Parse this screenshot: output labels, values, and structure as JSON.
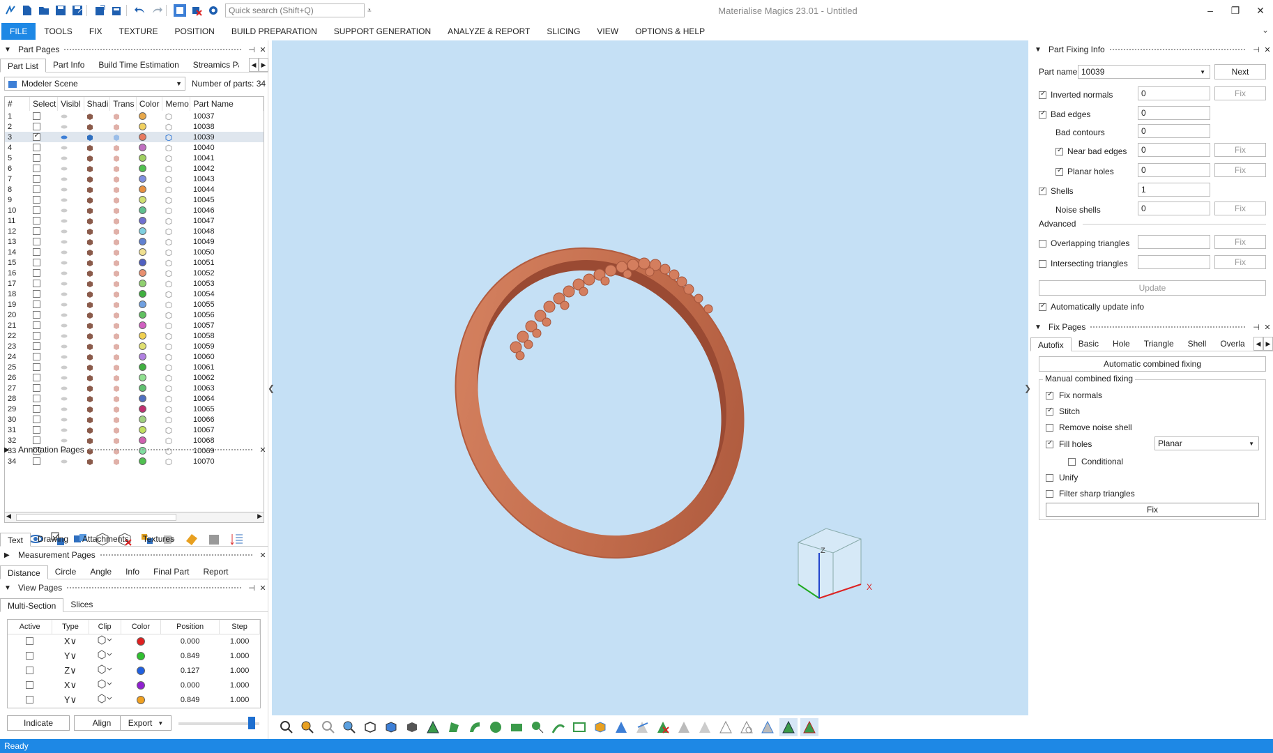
{
  "app": {
    "title": "Materialise Magics 23.01 - Untitled"
  },
  "quick_search": {
    "placeholder": "Quick search (Shift+Q)"
  },
  "ribbon": {
    "tabs": [
      "FILE",
      "TOOLS",
      "FIX",
      "TEXTURE",
      "POSITION",
      "BUILD PREPARATION",
      "SUPPORT GENERATION",
      "ANALYZE & REPORT",
      "SLICING",
      "VIEW",
      "OPTIONS & HELP"
    ]
  },
  "part_pages": {
    "title": "Part Pages",
    "tabs": [
      "Part List",
      "Part Info",
      "Build Time Estimation",
      "Streamics Part"
    ],
    "scene": "Modeler Scene",
    "number_of_parts_label": "Number of parts:",
    "number_of_parts": "34",
    "columns": [
      "#",
      "Select",
      "Visibl",
      "Shadi",
      "Trans",
      "Color",
      "Memo",
      "Part Name"
    ],
    "rows": [
      {
        "n": "1",
        "name": "10037",
        "color": "#e8a84a"
      },
      {
        "n": "2",
        "name": "10038",
        "color": "#f0d060"
      },
      {
        "n": "3",
        "name": "10039",
        "color": "#e87a60",
        "selected": true
      },
      {
        "n": "4",
        "name": "10040",
        "color": "#c070c0"
      },
      {
        "n": "5",
        "name": "10041",
        "color": "#a0d060"
      },
      {
        "n": "6",
        "name": "10042",
        "color": "#50c050"
      },
      {
        "n": "7",
        "name": "10043",
        "color": "#8090e0"
      },
      {
        "n": "8",
        "name": "10044",
        "color": "#e89040"
      },
      {
        "n": "9",
        "name": "10045",
        "color": "#d0e070"
      },
      {
        "n": "10",
        "name": "10046",
        "color": "#60c090"
      },
      {
        "n": "11",
        "name": "10047",
        "color": "#7070d0"
      },
      {
        "n": "12",
        "name": "10048",
        "color": "#80d0e0"
      },
      {
        "n": "13",
        "name": "10049",
        "color": "#6080d0"
      },
      {
        "n": "14",
        "name": "10050",
        "color": "#f0e090"
      },
      {
        "n": "15",
        "name": "10051",
        "color": "#5060c0"
      },
      {
        "n": "16",
        "name": "10052",
        "color": "#e89070"
      },
      {
        "n": "17",
        "name": "10053",
        "color": "#90d070"
      },
      {
        "n": "18",
        "name": "10054",
        "color": "#40b040"
      },
      {
        "n": "19",
        "name": "10055",
        "color": "#70a0e0"
      },
      {
        "n": "20",
        "name": "10056",
        "color": "#60c060"
      },
      {
        "n": "21",
        "name": "10057",
        "color": "#d060c0"
      },
      {
        "n": "22",
        "name": "10058",
        "color": "#f0d050"
      },
      {
        "n": "23",
        "name": "10059",
        "color": "#e0e070"
      },
      {
        "n": "24",
        "name": "10060",
        "color": "#b080e0"
      },
      {
        "n": "25",
        "name": "10061",
        "color": "#40b040"
      },
      {
        "n": "26",
        "name": "10062",
        "color": "#90e090"
      },
      {
        "n": "27",
        "name": "10063",
        "color": "#60c070"
      },
      {
        "n": "28",
        "name": "10064",
        "color": "#5070c0"
      },
      {
        "n": "29",
        "name": "10065",
        "color": "#c03070"
      },
      {
        "n": "30",
        "name": "10066",
        "color": "#a0d080"
      },
      {
        "n": "31",
        "name": "10067",
        "color": "#c0e060"
      },
      {
        "n": "32",
        "name": "10068",
        "color": "#d060b0"
      },
      {
        "n": "33",
        "name": "10069",
        "color": "#80e0a0"
      },
      {
        "n": "34",
        "name": "10070",
        "color": "#50c050"
      }
    ]
  },
  "annotation_pages": {
    "title": "Annotation Pages",
    "tabs": [
      "Text",
      "Drawing",
      "Attachments",
      "Textures"
    ]
  },
  "measurement_pages": {
    "title": "Measurement Pages",
    "tabs": [
      "Distance",
      "Circle",
      "Angle",
      "Info",
      "Final Part",
      "Report"
    ]
  },
  "view_pages": {
    "title": "View Pages",
    "tabs": [
      "Multi-Section",
      "Slices"
    ],
    "columns": [
      "Active",
      "Type",
      "Clip",
      "Color",
      "Position",
      "Step"
    ],
    "rows": [
      {
        "type": "X∨",
        "color": "#e02020",
        "position": "0.000",
        "step": "1.000"
      },
      {
        "type": "Y∨",
        "color": "#30c030",
        "position": "0.849",
        "step": "1.000"
      },
      {
        "type": "Z∨",
        "color": "#2060e0",
        "position": "0.127",
        "step": "1.000"
      },
      {
        "type": "X∨",
        "color": "#9020d0",
        "position": "0.000",
        "step": "1.000"
      },
      {
        "type": "Y∨",
        "color": "#f0a020",
        "position": "0.849",
        "step": "1.000"
      }
    ],
    "buttons": {
      "indicate": "Indicate",
      "align": "Align",
      "export": "Export"
    }
  },
  "part_fixing_info": {
    "title": "Part Fixing Info",
    "part_name_label": "Part name",
    "part_name": "10039",
    "next": "Next",
    "items": [
      {
        "label": "Inverted normals",
        "value": "0",
        "checked": true,
        "fix": true,
        "indent": 0
      },
      {
        "label": "Bad edges",
        "value": "0",
        "checked": true,
        "fix": false,
        "indent": 0
      },
      {
        "label": "Bad contours",
        "value": "0",
        "checked": null,
        "fix": false,
        "indent": 1
      },
      {
        "label": "Near bad edges",
        "value": "0",
        "checked": true,
        "fix": true,
        "indent": 2
      },
      {
        "label": "Planar holes",
        "value": "0",
        "checked": true,
        "fix": true,
        "indent": 2
      },
      {
        "label": "Shells",
        "value": "1",
        "checked": true,
        "fix": false,
        "indent": 0
      },
      {
        "label": "Noise shells",
        "value": "0",
        "checked": null,
        "fix": true,
        "indent": 1
      }
    ],
    "advanced_label": "Advanced",
    "advanced": [
      {
        "label": "Overlapping triangles",
        "value": "",
        "checked": false
      },
      {
        "label": "Intersecting triangles",
        "value": "",
        "checked": false
      }
    ],
    "fix_label": "Fix",
    "update": "Update",
    "auto_update": "Automatically update info"
  },
  "fix_pages": {
    "title": "Fix Pages",
    "tabs": [
      "Autofix",
      "Basic",
      "Hole",
      "Triangle",
      "Shell",
      "Overla"
    ],
    "auto_combined": "Automatic combined fixing",
    "manual_label": "Manual combined fixing",
    "options": [
      {
        "label": "Fix normals",
        "checked": true,
        "indent": 0
      },
      {
        "label": "Stitch",
        "checked": true,
        "indent": 0
      },
      {
        "label": "Remove noise shell",
        "checked": false,
        "indent": 0
      },
      {
        "label": "Fill holes",
        "checked": true,
        "indent": 0
      },
      {
        "label": "Conditional",
        "checked": false,
        "indent": 1
      },
      {
        "label": "Unify",
        "checked": false,
        "indent": 0
      },
      {
        "label": "Filter sharp triangles",
        "checked": false,
        "indent": 0
      }
    ],
    "fill_mode": "Planar",
    "fix_button": "Fix"
  },
  "statusbar": {
    "text": "Ready"
  },
  "colors": {
    "accent": "#1e88e5",
    "viewport": "#c5e0f5",
    "ring": "#c8704f"
  }
}
